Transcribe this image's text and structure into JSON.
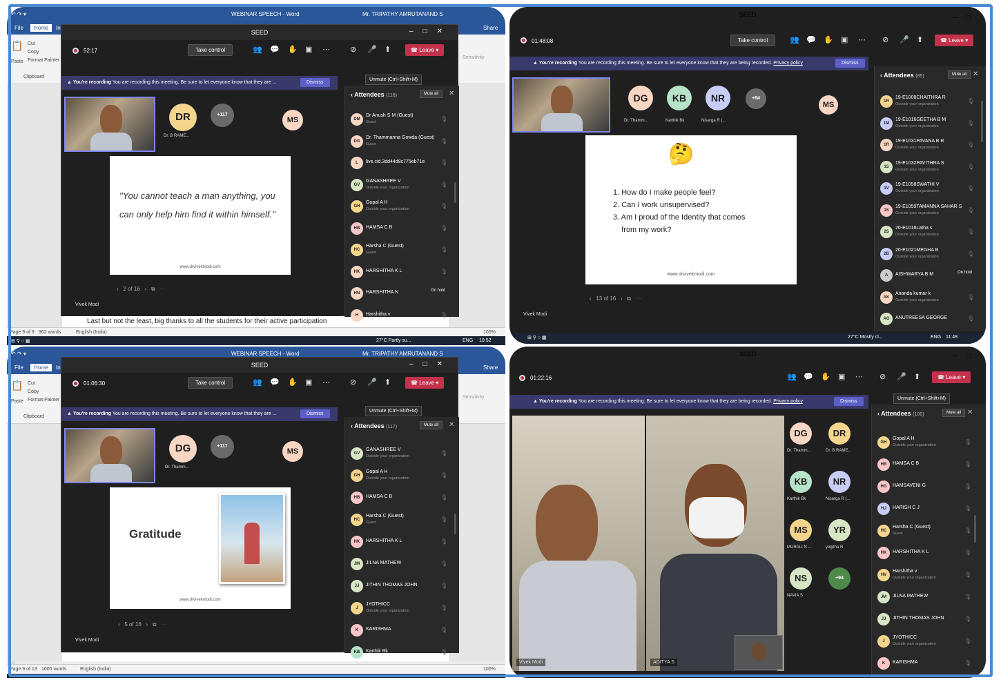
{
  "word1": {
    "title": "WEBINAR SPEECH - Word",
    "user": "Mr. TRIPATHY AMRUTANAND S",
    "tabs": [
      "File",
      "Home",
      "In"
    ],
    "share": "Share",
    "clipboard": [
      "Cut",
      "Copy",
      "Format Painter"
    ],
    "paste": "Paste",
    "clipboard_label": "Clipboard",
    "sensitivity": "Sensitivity",
    "doc_text": "Last but not the least, big thanks to all the students for their active participation",
    "status": {
      "page": "Page 9 of 9",
      "words": "962 words",
      "lang": "English (India)",
      "zoom": "100%"
    },
    "taskbar": {
      "weather": "27°C  Partly su...",
      "lang": "ENG",
      "time": "10:52"
    }
  },
  "word3": {
    "title": "WEBINAR SPEECH - Word",
    "user": "Mr. TRIPATHY AMRUTANAND S",
    "tabs": [
      "File",
      "Home",
      "In"
    ],
    "share": "Share",
    "clipboard": [
      "Cut",
      "Copy",
      "Format Painter"
    ],
    "paste": "Paste",
    "clipboard_label": "Clipboard",
    "sensitivity": "Sensitivity",
    "status": {
      "page": "Page 9 of 13",
      "words": "1005 words",
      "lang": "English (India)",
      "zoom": "100%"
    }
  },
  "meeting1": {
    "title": "SEED",
    "timer": "52:17",
    "take_control": "Take control",
    "leave": "Leave",
    "tooltip": "Unmute (Ctrl+Shift+M)",
    "banner_bold": "You're recording",
    "banner_text": "You are recording this meeting. Be sure to let everyone know that they are ...",
    "dismiss": "Dismiss",
    "avatars": [
      {
        "initials": "DR",
        "label": "Dr. B RAME...",
        "color": "#f4d58d"
      },
      {
        "initials": "+117",
        "label": "",
        "color": "#6a6a6a"
      },
      {
        "initials": "MS",
        "label": "",
        "color": "#f8d6c4"
      }
    ],
    "quote": "\"You cannot teach a man anything, you can only help him find it within himself.\"",
    "slide_url": "www.drvivekmodi.com",
    "page_counter": "2 of 16",
    "presenter": "Vivek Modi",
    "attendees_title": "Attendees",
    "attendees_count": "(116)",
    "mute_all": "Mute all",
    "attendees": [
      {
        "initials": "DM",
        "name": "Dr Anush S M (Guest)",
        "sub": "Guest",
        "color": "#f8d6c4"
      },
      {
        "initials": "DG",
        "name": "Dr. Thammanna Gowda (Guest)",
        "sub": "Guest",
        "color": "#f8d6c4"
      },
      {
        "initials": "L",
        "name": "live.cid.3dd44d8c775eb71e",
        "sub": "",
        "color": "#f8d6c4"
      },
      {
        "initials": "GV",
        "name": "GANASHREE V",
        "sub": "Outside your organization",
        "color": "#d7e6c4"
      },
      {
        "initials": "GH",
        "name": "Gopal A H",
        "sub": "Outside your organization",
        "color": "#f4d58d"
      },
      {
        "initials": "HB",
        "name": "HAMSA C B",
        "sub": "",
        "color": "#f8c6c6"
      },
      {
        "initials": "HC",
        "name": "Harsha C (Guest)",
        "sub": "Guest",
        "color": "#f4d58d"
      },
      {
        "initials": "HK",
        "name": "HARSHITHA K L",
        "sub": "",
        "color": "#f8d6c4"
      },
      {
        "initials": "HN",
        "name": "HARSHITHA N",
        "sub": "",
        "color": "#f8d6c4",
        "status": "On hold"
      },
      {
        "initials": "H",
        "name": "Harshitha v",
        "sub": "",
        "color": "#f8d6c4"
      }
    ]
  },
  "meeting2": {
    "title": "SEED",
    "timer": "01:48:08",
    "take_control": "Take control",
    "leave": "Leave",
    "banner_bold": "You're recording",
    "banner_text": "You are recording this meeting. Be sure to let everyone know that they are being recorded.",
    "privacy": "Privacy policy",
    "dismiss": "Dismiss",
    "avatars": [
      {
        "initials": "DG",
        "label": "Dr. Thamm...",
        "color": "#f8d6c4"
      },
      {
        "initials": "KB",
        "label": "Karthik Bk",
        "color": "#b7e3c8"
      },
      {
        "initials": "NR",
        "label": "Nisarga R (...",
        "color": "#c7cdf5"
      },
      {
        "initials": "+84",
        "label": "",
        "color": "#6a6a6a"
      },
      {
        "initials": "MS",
        "label": "",
        "color": "#f8d6c4"
      }
    ],
    "slide_emoji": "🤔",
    "slide_items": [
      "1. How do I make people feel?",
      "2. Can I work unsupervised?",
      "3. Am I proud of the Identity that comes",
      "    from my work?"
    ],
    "slide_url": "www.drvivekmodi.com",
    "page_counter": "13 of 16",
    "presenter": "Vivek Modi",
    "attendees_title": "Attendees",
    "attendees_count": "(85)",
    "mute_all": "Mute all",
    "attendees": [
      {
        "initials": "1R",
        "name": "19-E1008CHAITHRA R",
        "sub": "Outside your organization",
        "color": "#f4d58d"
      },
      {
        "initials": "1M",
        "name": "19-E1016GEETHA B M",
        "sub": "Outside your organization",
        "color": "#c7cdf5"
      },
      {
        "initials": "1R",
        "name": "19-E1031PAVANA B R",
        "sub": "Outside your organization",
        "color": "#f8d6c4"
      },
      {
        "initials": "1S",
        "name": "19-E1032PAVITHRA S",
        "sub": "Outside your organization",
        "color": "#d7e6c4"
      },
      {
        "initials": "1V",
        "name": "19-E1058SWATHI V",
        "sub": "Outside your organization",
        "color": "#c7cdf5"
      },
      {
        "initials": "1S",
        "name": "19-E1059TAMANNA SAHAR S",
        "sub": "Outside your organization",
        "color": "#f8c6c6"
      },
      {
        "initials": "2S",
        "name": "20-E1016Latha s",
        "sub": "Outside your organization",
        "color": "#d7e6c4"
      },
      {
        "initials": "2B",
        "name": "20-E1021MEGHA B",
        "sub": "Outside your organization",
        "color": "#c7cdf5"
      },
      {
        "initials": "A",
        "name": "AISHWARYA B M",
        "sub": "",
        "color": "#cccccc",
        "status": "On hold"
      },
      {
        "initials": "AK",
        "name": "Ananda kumar k",
        "sub": "Outside your organization",
        "color": "#f8d6c4"
      },
      {
        "initials": "AG",
        "name": "ANUTREESA GEORGE",
        "sub": "",
        "color": "#d7e6c4"
      }
    ],
    "taskbar": {
      "weather": "27°C  Mostly cl...",
      "lang": "ENG",
      "time": "11:48"
    }
  },
  "meeting3": {
    "title": "SEED",
    "timer": "01:06:30",
    "take_control": "Take control",
    "leave": "Leave",
    "tooltip": "Unmute (Ctrl+Shift+M)",
    "banner_bold": "You're recording",
    "banner_text": "You are recording this meeting. Be sure to let everyone know that they are ...",
    "dismiss": "Dismiss",
    "avatars": [
      {
        "initials": "DG",
        "label": "Dr. Thamm...",
        "color": "#f8d6c4"
      },
      {
        "initials": "+117",
        "label": "",
        "color": "#6a6a6a"
      },
      {
        "initials": "MS",
        "label": "",
        "color": "#f8d6c4"
      }
    ],
    "slide_title": "Gratitude",
    "slide_url": "www.drvivekmodi.com",
    "page_counter": "5 of 16",
    "presenter": "Vivek Modi",
    "attendees_title": "Attendees",
    "attendees_count": "(117)",
    "mute_all": "Mute all",
    "attendees": [
      {
        "initials": "GV",
        "name": "GANASHREE V",
        "sub": "Outside your organization",
        "color": "#d7e6c4"
      },
      {
        "initials": "GH",
        "name": "Gopal A H",
        "sub": "Outside your organization",
        "color": "#f4d58d"
      },
      {
        "initials": "HB",
        "name": "HAMSA C B",
        "sub": "",
        "color": "#f8c6c6"
      },
      {
        "initials": "HC",
        "name": "Harsha C (Guest)",
        "sub": "Guest",
        "color": "#f4d58d"
      },
      {
        "initials": "HK",
        "name": "HARSHITHA K L",
        "sub": "",
        "color": "#f8c6c6"
      },
      {
        "initials": "JM",
        "name": "JILNA MATHEW",
        "sub": "",
        "color": "#d7e6c4"
      },
      {
        "initials": "JJ",
        "name": "JITHIN THOMAS JOHN",
        "sub": "",
        "color": "#d7e6c4"
      },
      {
        "initials": "J",
        "name": "JYOTHICC",
        "sub": "Outside your organization",
        "color": "#f4d58d"
      },
      {
        "initials": "K",
        "name": "KARISHMA",
        "sub": "",
        "color": "#f8c6c6"
      },
      {
        "initials": "KB",
        "name": "Karthik Bk",
        "sub": "",
        "color": "#b7e3c8"
      }
    ]
  },
  "meeting4": {
    "title": "SEED",
    "timer": "01:22:16",
    "leave": "Leave",
    "tooltip": "Unmute (Ctrl+Shift+M)",
    "banner_bold": "You're recording",
    "banner_text": "You are recording this meeting. Be sure to let everyone know that they are being recorded.",
    "privacy": "Privacy policy",
    "dismiss": "Dismiss",
    "avatars": [
      {
        "initials": "DG",
        "label": "Dr. Thamm...",
        "color": "#f8d6c4"
      },
      {
        "initials": "DR",
        "label": "Dr. B RAME...",
        "color": "#f4d58d"
      },
      {
        "initials": "KB",
        "label": "Karthik Bk",
        "color": "#b7e3c8"
      },
      {
        "initials": "NR",
        "label": "Nisarga R (...",
        "color": "#c7cdf5"
      },
      {
        "initials": "MS",
        "label": "MURALI N ...",
        "color": "#f4d58d"
      },
      {
        "initials": "YR",
        "label": "yogitha R",
        "color": "#d7e6c4"
      },
      {
        "initials": "NS",
        "label": "NAVIA S",
        "color": "#d7e6c4"
      },
      {
        "initials": "+94",
        "label": "",
        "color": "#4f8a4b"
      }
    ],
    "video_labels": [
      "Vivek Modi",
      "ADITYA S"
    ],
    "attendees_title": "Attendees",
    "attendees_count": "(100)",
    "mute_all": "Mute all",
    "attendees": [
      {
        "initials": "GH",
        "name": "Gopal A H",
        "sub": "Outside your organization",
        "color": "#f4d58d"
      },
      {
        "initials": "HB",
        "name": "HAMSA C B",
        "sub": "",
        "color": "#f8c6c6"
      },
      {
        "initials": "HG",
        "name": "HAMSAVENI G",
        "sub": "",
        "color": "#f8c6c6"
      },
      {
        "initials": "HJ",
        "name": "HARISH C J",
        "sub": "",
        "color": "#c7cdf5"
      },
      {
        "initials": "HC",
        "name": "Harsha C (Guest)",
        "sub": "Guest",
        "color": "#f4d58d"
      },
      {
        "initials": "HK",
        "name": "HARSHITHA K L",
        "sub": "",
        "color": "#f8c6c6"
      },
      {
        "initials": "HV",
        "name": "Harshitha v",
        "sub": "Outside your organization",
        "color": "#f4d58d"
      },
      {
        "initials": "JM",
        "name": "JILNA MATHEW",
        "sub": "",
        "color": "#d7e6c4"
      },
      {
        "initials": "JJ",
        "name": "JITHIN THOMAS JOHN",
        "sub": "",
        "color": "#d7e6c4"
      },
      {
        "initials": "J",
        "name": "JYOTHICC",
        "sub": "Outside your organization",
        "color": "#f4d58d"
      },
      {
        "initials": "K",
        "name": "KARISHMA",
        "sub": "",
        "color": "#f8c6c6"
      }
    ]
  }
}
